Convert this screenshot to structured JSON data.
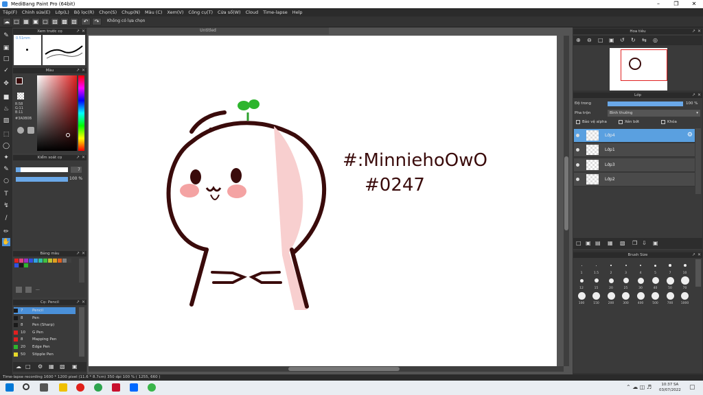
{
  "window": {
    "title": "MediBang Paint Pro (64bit)"
  },
  "menu": [
    "Tệp(F)",
    "Chỉnh sửa(E)",
    "Lớp(L)",
    "Bộ lọc(R)",
    "Chọn(S)",
    "Chụp(N)",
    "Màu (C)",
    "Xem(V)",
    "Công cụ(T)",
    "Cửa sổ(W)",
    "Cloud",
    "Time-lapse",
    "Help"
  ],
  "toolbar": {
    "selection_text": "Không có lựa chọn"
  },
  "brush_preview": {
    "title": "Xem trước cọ",
    "size_label": "0.51mm"
  },
  "color_panel": {
    "title": "Màu",
    "r": "R:58",
    "g": "G:11",
    "b": "B:11",
    "hex": "#3A0B0B",
    "current_color": "#3A0B0B"
  },
  "brush_control": {
    "title": "Kiểm soát cọ",
    "size_value": "7",
    "opacity_value": "100 %",
    "opacity_level": 1.0
  },
  "palette": {
    "title": "Bảng màu",
    "more": "..."
  },
  "brush_list": {
    "title": "Cọ: Pencil",
    "items": [
      {
        "size": "7",
        "name": "Pencil",
        "color": "#1a1a1a"
      },
      {
        "size": "8",
        "name": "Pen",
        "color": "#1a1a1a"
      },
      {
        "size": "8",
        "name": "Pen (Sharp)",
        "color": "#1a1a1a"
      },
      {
        "size": "10",
        "name": "G Pen",
        "color": "#e02020"
      },
      {
        "size": "8",
        "name": "Mapping Pen",
        "color": "#e02020"
      },
      {
        "size": "20",
        "name": "Edge Pen",
        "color": "#2db52d"
      },
      {
        "size": "50",
        "name": "Stipple Pen",
        "color": "#e6d82a"
      }
    ]
  },
  "canvas": {
    "tab_title": "Untitled"
  },
  "artwork_text": {
    "line1": "#:MinniehoOwO",
    "line2": "#0247"
  },
  "navigator": {
    "title": "Hoa tiêu"
  },
  "layers_panel": {
    "title": "Lớp",
    "opacity_label": "Độ trong",
    "opacity_value": "100 %",
    "opacity_level": 1.0,
    "blend_label": "Pha trộn",
    "blend_value": "Bình thường",
    "protect_alpha": "Bảo vệ alpha",
    "clipping": "Xén bớt",
    "lock": "Khóa",
    "layers": [
      {
        "name": "Lớp4",
        "selected": true
      },
      {
        "name": "Lớp1",
        "selected": false
      },
      {
        "name": "Lớp3",
        "selected": false
      },
      {
        "name": "Lớp2",
        "selected": false
      }
    ]
  },
  "brush_size_panel": {
    "title": "Brush Size",
    "sizes": [
      "1",
      "1.5",
      "2",
      "3",
      "4",
      "5",
      "7",
      "10",
      "12",
      "15",
      "20",
      "25",
      "30",
      "40",
      "50",
      "70",
      "100",
      "150",
      "200",
      "300",
      "400",
      "500",
      "700",
      "1000"
    ]
  },
  "status": {
    "text": "Time-lapse recording   1600 * 1200 pixel  (11.6 * 8.7cm)  350 dpi  100 %  ( 1255, 660 )"
  },
  "taskbar": {
    "time": "10:37 SA",
    "date": "03/07/2022"
  }
}
